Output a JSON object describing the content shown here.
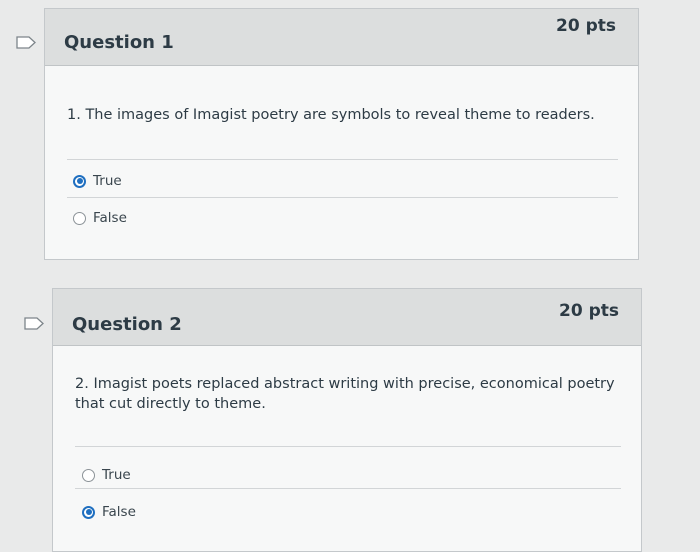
{
  "questions": [
    {
      "title": "Question 1",
      "points": "20 pts",
      "text": "1. The images of Imagist poetry are symbols to reveal theme to readers.",
      "answers": [
        {
          "label": "True",
          "selected": true
        },
        {
          "label": "False",
          "selected": false
        }
      ]
    },
    {
      "title": "Question 2",
      "points": "20 pts",
      "text": "2. Imagist poets replaced abstract writing with precise, economical poetry that cut directly to theme.",
      "answers": [
        {
          "label": "True",
          "selected": false
        },
        {
          "label": "False",
          "selected": true
        }
      ]
    }
  ],
  "colors": {
    "accent": "#1f6fc0",
    "header_bg": "#dcdede",
    "card_bg": "#f7f8f8"
  },
  "icons": {
    "flag": "flag-question-icon"
  }
}
